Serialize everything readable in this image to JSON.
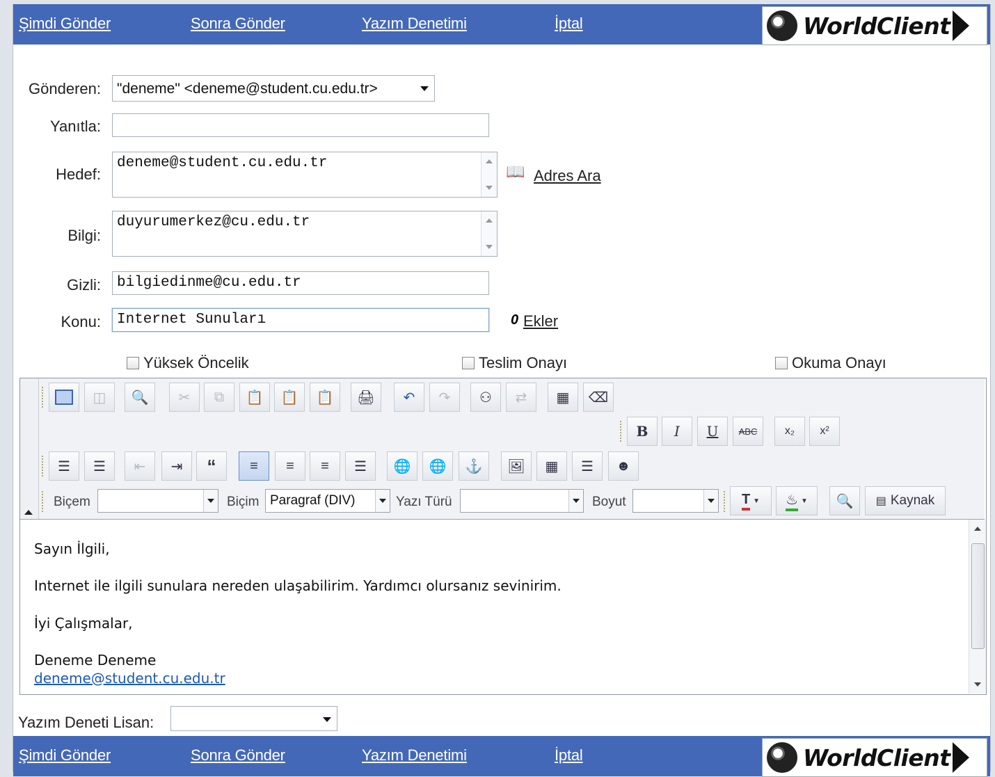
{
  "nav": {
    "send_now": "Şimdi Gönder",
    "send_later": "Sonra Gönder",
    "spell_check": "Yazım Denetimi",
    "cancel": "İptal",
    "logo_text": "WorldClient"
  },
  "form": {
    "from_label": "Gönderen:",
    "from_value": "\"deneme\" <deneme@student.cu.edu.tr>",
    "reply_label": "Yanıtla:",
    "reply_value": "",
    "to_label": "Hedef:",
    "to_value": "deneme@student.cu.edu.tr",
    "address_search": "Adres Ara",
    "cc_label": "Bilgi:",
    "cc_value": "duyurumerkez@cu.edu.tr",
    "bcc_label": "Gizli:",
    "bcc_value": "bilgiedinme@cu.edu.tr",
    "subject_label": "Konu:",
    "subject_value": "Internet Sunuları",
    "attachments": "Ekler",
    "attach_glyph": "0"
  },
  "options": {
    "high_priority": "Yüksek Öncelik",
    "delivery_receipt": "Teslim Onayı",
    "read_receipt": "Okuma Onayı"
  },
  "toolbar": {
    "style_label": "Biçem",
    "style_value": "",
    "format_label": "Biçim",
    "format_value": "Paragraf (DIV)",
    "font_label": "Yazı Türü",
    "font_value": "",
    "size_label": "Boyut",
    "size_value": "",
    "source_label": "Kaynak",
    "bold": "B",
    "italic": "I",
    "underline": "U",
    "strike": "ABC",
    "subscript": "x₂",
    "superscript": "x²"
  },
  "body": {
    "greeting": "Sayın İlgili,",
    "line1": "Internet ile ilgili sunulara nereden ulaşabilirim. Yardımcı olursanız sevinirim.",
    "closing": "İyi Çalışmalar,",
    "name": "Deneme Deneme",
    "email": "deneme@student.cu.edu.tr"
  },
  "footer": {
    "spell_lang_label": "Yazım Deneti Lisan:",
    "spell_lang_value": ""
  }
}
